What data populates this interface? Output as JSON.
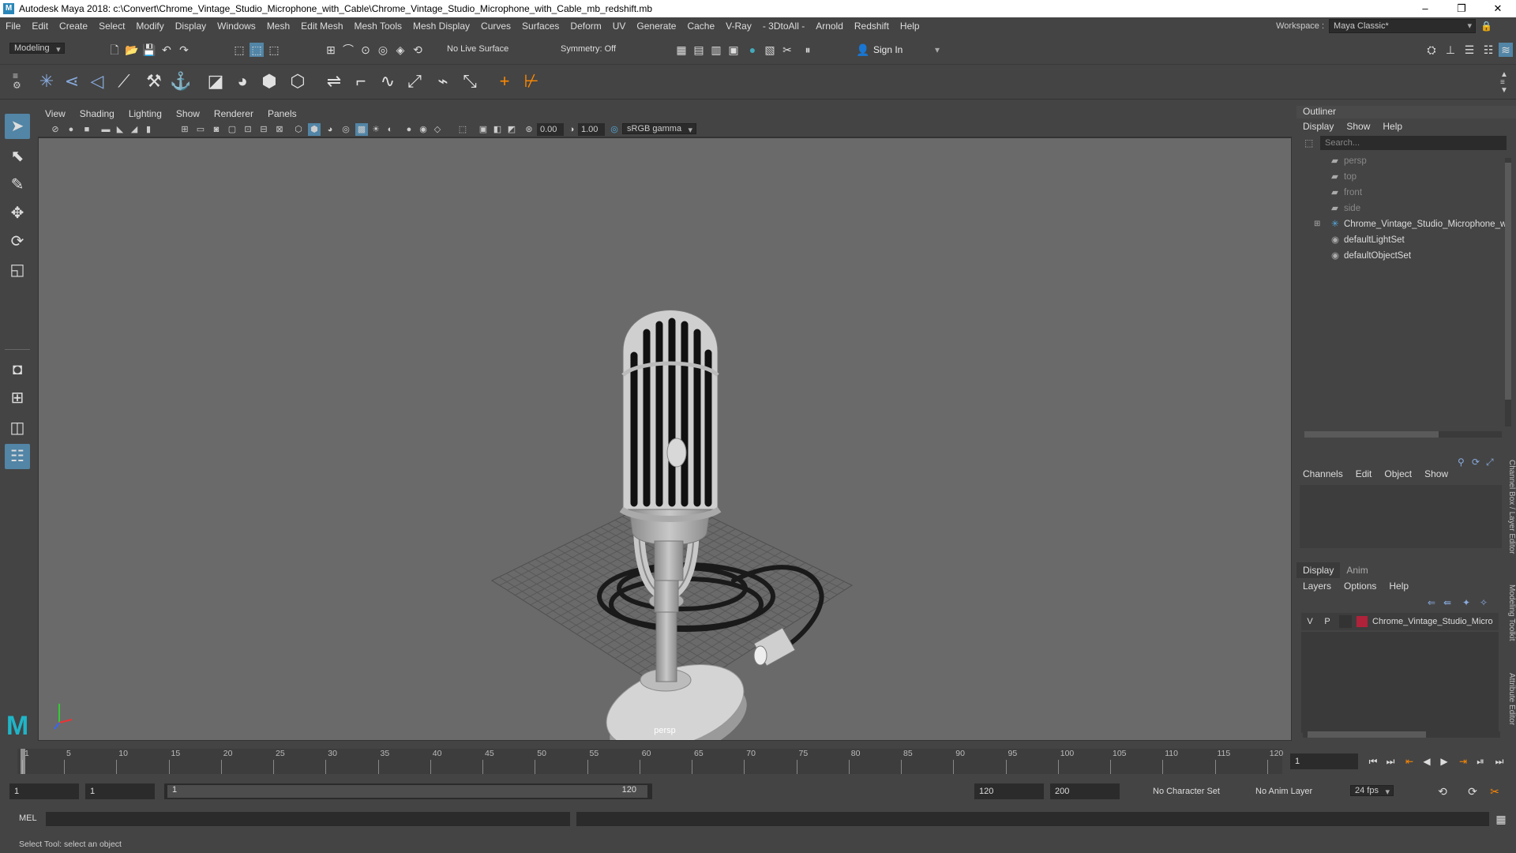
{
  "window": {
    "title": "Autodesk Maya 2018: c:\\Convert\\Chrome_Vintage_Studio_Microphone_with_Cable\\Chrome_Vintage_Studio_Microphone_with_Cable_mb_redshift.mb",
    "minimize": "–",
    "maximize": "❐",
    "close": "✕"
  },
  "menubar": {
    "items": [
      "File",
      "Edit",
      "Create",
      "Select",
      "Modify",
      "Display",
      "Windows",
      "Mesh",
      "Edit Mesh",
      "Mesh Tools",
      "Mesh Display",
      "Curves",
      "Surfaces",
      "Deform",
      "UV",
      "Generate",
      "Cache",
      "V-Ray",
      "- 3DtoAll -",
      "Arnold",
      "Redshift",
      "Help"
    ],
    "workspace_label": "Workspace :",
    "workspace_value": "Maya Classic*"
  },
  "statusline": {
    "mode": "Modeling",
    "live_surface": "No Live Surface",
    "symmetry": "Symmetry: Off",
    "sign_in": "Sign In"
  },
  "panel": {
    "menus": [
      "View",
      "Shading",
      "Lighting",
      "Show",
      "Renderer",
      "Panels"
    ],
    "exposure": "0.00",
    "gamma": "1.00",
    "color_space": "sRGB gamma",
    "camera": "persp"
  },
  "outliner": {
    "title": "Outliner",
    "menus": [
      "Display",
      "Show",
      "Help"
    ],
    "search_placeholder": "Search...",
    "items": [
      {
        "label": "persp",
        "icon": "camera-icon",
        "dim": true
      },
      {
        "label": "top",
        "icon": "camera-icon",
        "dim": true
      },
      {
        "label": "front",
        "icon": "camera-icon",
        "dim": true
      },
      {
        "label": "side",
        "icon": "camera-icon",
        "dim": true
      },
      {
        "label": "Chrome_Vintage_Studio_Microphone_w",
        "icon": "transform-icon",
        "dim": false
      },
      {
        "label": "defaultLightSet",
        "icon": "set-icon",
        "dim": false
      },
      {
        "label": "defaultObjectSet",
        "icon": "set-icon",
        "dim": false
      }
    ]
  },
  "channelbox": {
    "menus": [
      "Channels",
      "Edit",
      "Object",
      "Show"
    ]
  },
  "layers": {
    "tabs": [
      "Display",
      "Anim"
    ],
    "menus": [
      "Layers",
      "Options",
      "Help"
    ],
    "row": {
      "v": "V",
      "p": "P",
      "name": "Chrome_Vintage_Studio_Micro",
      "color": "#b0223a"
    }
  },
  "side_tabs": [
    "Channel Box / Layer Editor",
    "Modeling Toolkit",
    "Attribute Editor"
  ],
  "timeline": {
    "ticks": [
      "1",
      "5",
      "10",
      "15",
      "20",
      "25",
      "30",
      "35",
      "40",
      "45",
      "50",
      "55",
      "60",
      "65",
      "70",
      "75",
      "80",
      "85",
      "90",
      "95",
      "100",
      "105",
      "110",
      "115",
      "120"
    ],
    "current_frame": "1"
  },
  "range": {
    "start": "1",
    "playback_start": "1",
    "slider_start": "1",
    "slider_end": "120",
    "playback_end": "120",
    "end": "200",
    "character_set": "No Character Set",
    "anim_layer": "No Anim Layer",
    "fps": "24 fps"
  },
  "cmdline": {
    "label": "MEL"
  },
  "helpline": {
    "text": "Select Tool: select an object"
  }
}
